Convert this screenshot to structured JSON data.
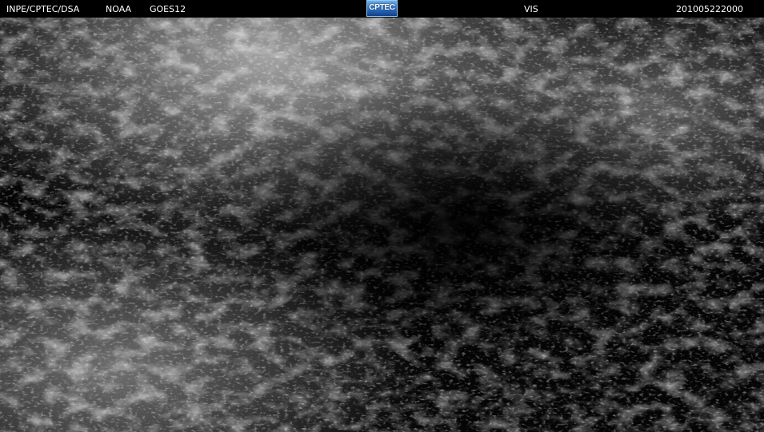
{
  "header": {
    "agency": "INPE/CPTEC/DSA",
    "source": "NOAA",
    "satellite": "GOES12",
    "logo_text": "CPTEC",
    "channel": "VIS",
    "timestamp": "201005222000"
  },
  "colors": {
    "background": "#000000",
    "text": "#ffffff",
    "logo_blue": "#2c6fc0"
  }
}
